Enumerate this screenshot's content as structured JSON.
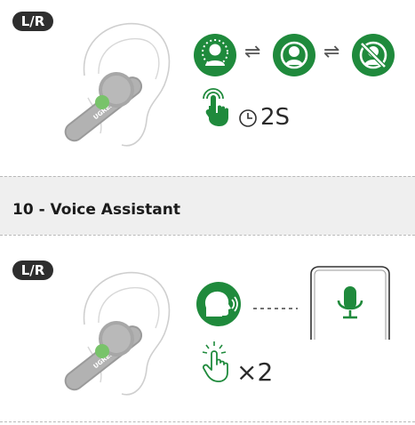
{
  "panel_top": {
    "side_badge": "L/R",
    "earbud_brand": "UGREEN",
    "mode_arrow_1": "⇌",
    "mode_arrow_2": "⇌",
    "hold_duration": "2S",
    "icons": [
      "earbud-icon",
      "anc-transparency-mode-icon",
      "normal-mode-icon",
      "anc-off-mode-icon",
      "touch-hold-icon",
      "clock-icon"
    ]
  },
  "section": {
    "title": "10 - Voice Assistant"
  },
  "panel_bottom": {
    "side_badge": "L/R",
    "earbud_brand": "UGREEN",
    "tap_count": "×2",
    "icons": [
      "earbud-icon",
      "speaking-head-icon",
      "dotted-connector",
      "phone-icon",
      "microphone-icon",
      "double-tap-icon"
    ]
  },
  "colors": {
    "accent_green": "#1f8a3c",
    "badge_dark": "#2e2e2e",
    "band_gray": "#efefef",
    "touch_green": "#78c36a"
  }
}
